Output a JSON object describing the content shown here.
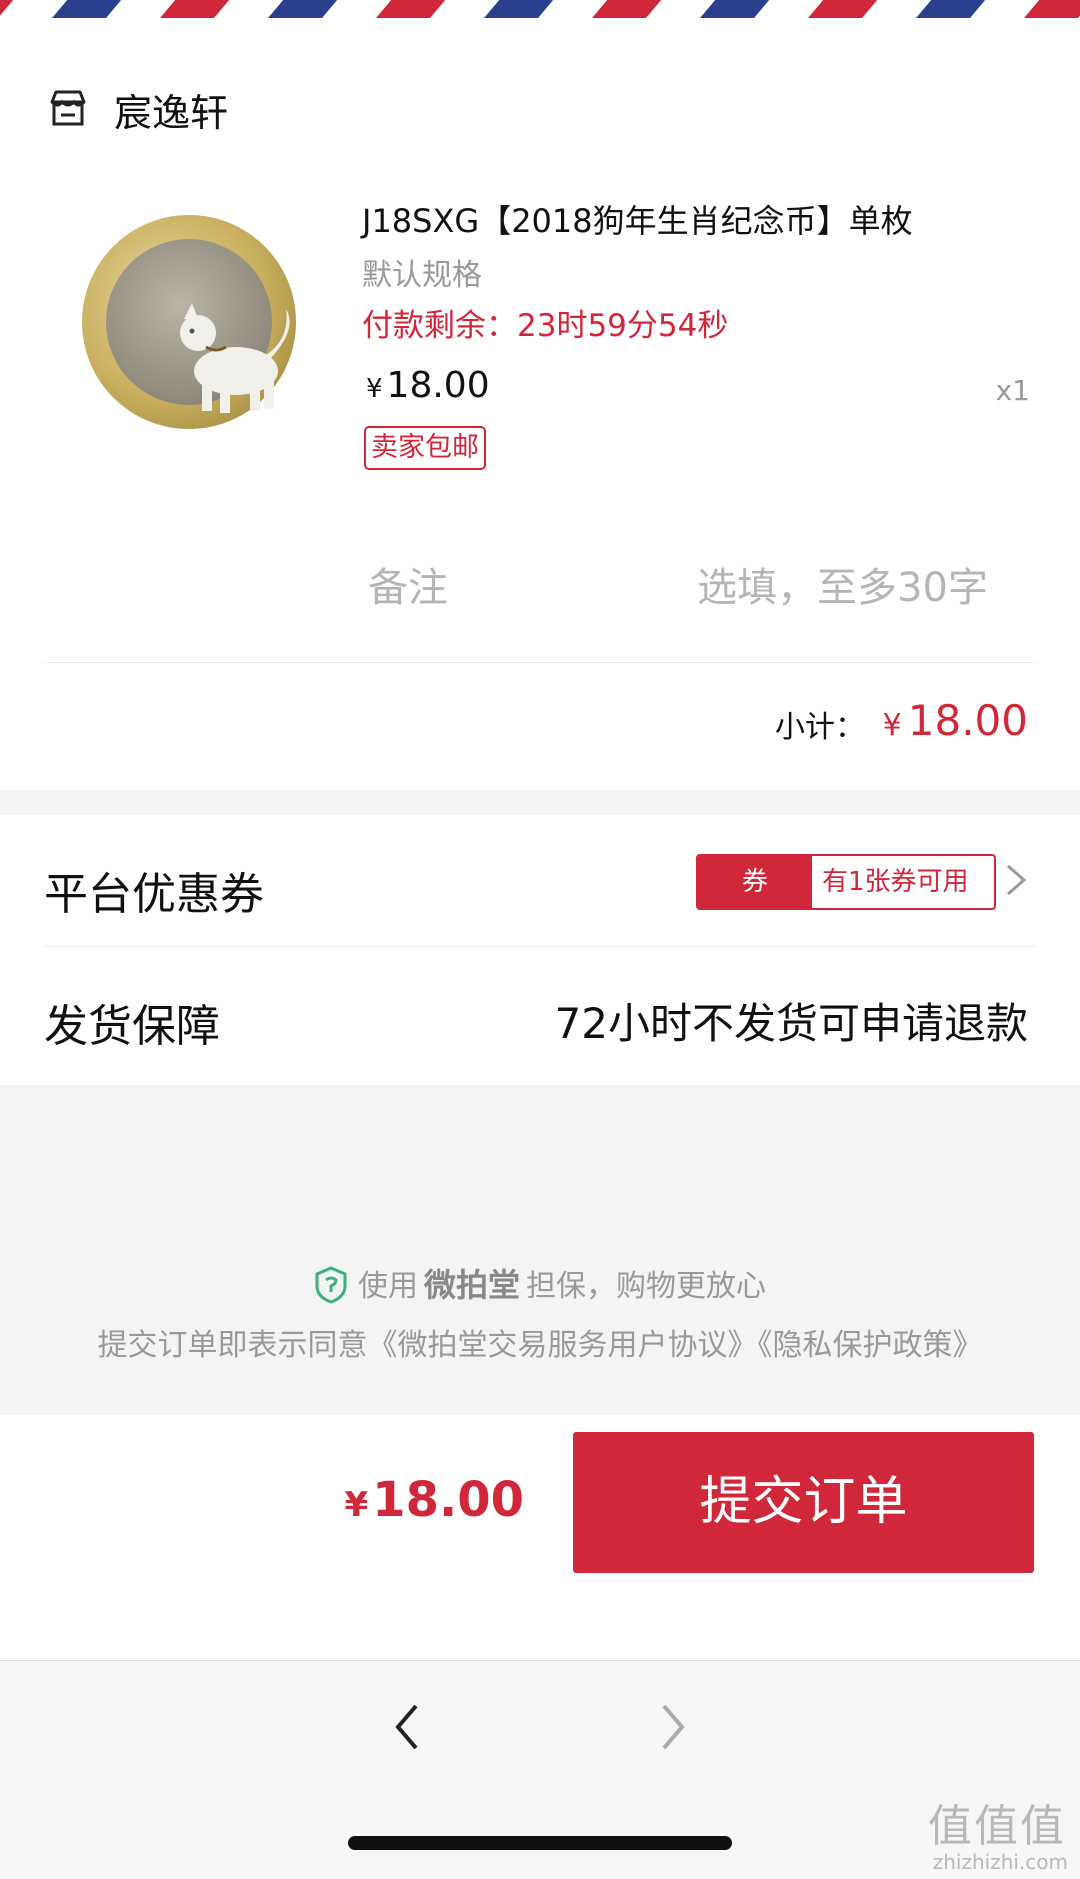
{
  "shop": {
    "name": "宸逸轩",
    "icon": "store-icon"
  },
  "product": {
    "title": "J18SXG【2018狗年生肖纪念币】单枚",
    "spec": "默认规格",
    "countdown": "付款剩余：23时59分54秒",
    "currency": "¥",
    "price": "18.00",
    "quantity": "x1",
    "badge": "卖家包邮",
    "image": "dog-coin-image"
  },
  "remark": {
    "label": "备注",
    "placeholder": "选填，至多30字"
  },
  "subtotal": {
    "label": "小计：",
    "currency": "¥",
    "value": "18.00"
  },
  "coupon": {
    "title": "平台优惠券",
    "tag": "券",
    "text": "有1张券可用"
  },
  "guarantee": {
    "title": "发货保障",
    "value": "72小时不发货可申请退款"
  },
  "footer": {
    "secure_prefix": "使用",
    "brand": "微拍堂",
    "secure_suffix": "担保，购物更放心",
    "agreement": "提交订单即表示同意《微拍堂交易服务用户协议》《隐私保护政策》"
  },
  "checkout": {
    "currency": "¥",
    "total": "18.00",
    "submit_label": "提交订单"
  },
  "watermark": {
    "text": "值值值",
    "url": "zhizhizhi.com"
  },
  "colors": {
    "accent": "#d1273a",
    "muted": "#999999",
    "airmail_red": "#d1273a",
    "airmail_blue": "#2b3f8f"
  }
}
